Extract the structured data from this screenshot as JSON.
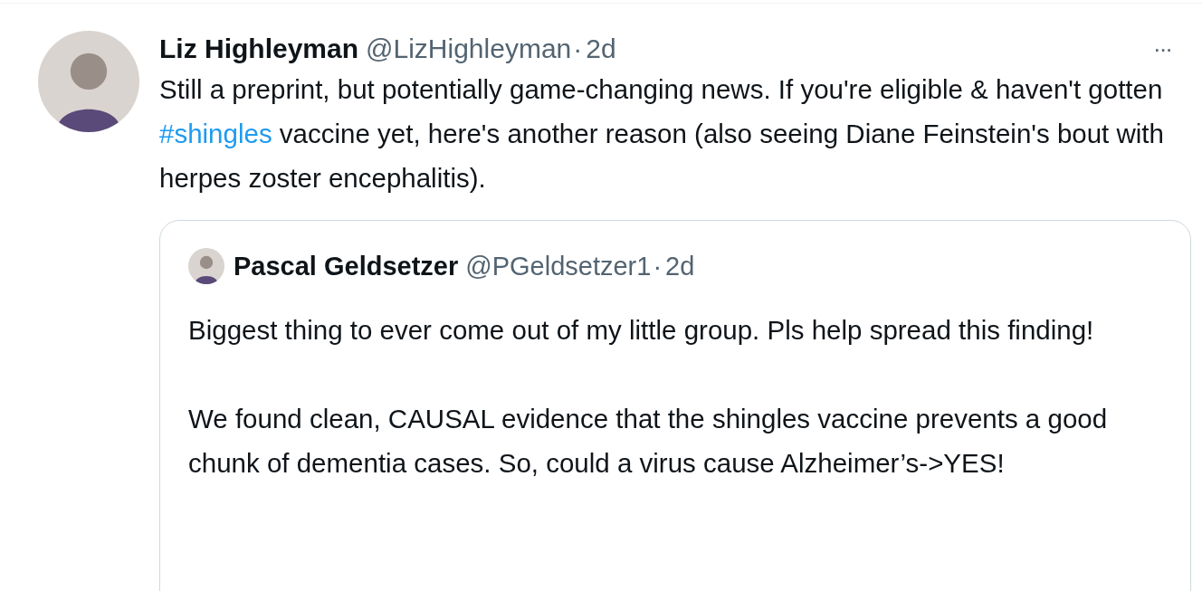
{
  "tweet": {
    "author": {
      "name": "Liz Highleyman",
      "handle": "@LizHighleyman",
      "separator": "·",
      "time": "2d"
    },
    "more": "···",
    "text_parts": [
      {
        "kind": "text",
        "text": "Still a preprint, but potentially game-changing news. If you're eligible & haven't gotten "
      },
      {
        "kind": "hashtag",
        "text": "#shingles"
      },
      {
        "kind": "text",
        "text": " vaccine yet, here's another reason (also seeing Diane Feinstein's bout with herpes zoster encephalitis)."
      }
    ],
    "quote": {
      "author": {
        "name": "Pascal Geldsetzer",
        "handle": "@PGeldsetzer1",
        "separator": "·",
        "time": "2d"
      },
      "paragraphs": [
        "Biggest thing to ever come out of my little group. Pls help spread this finding!",
        "We found clean, CAUSAL evidence that the shingles vaccine prevents a good chunk of dementia cases. So, could a virus cause Alzheimer’s->YES!"
      ]
    }
  }
}
